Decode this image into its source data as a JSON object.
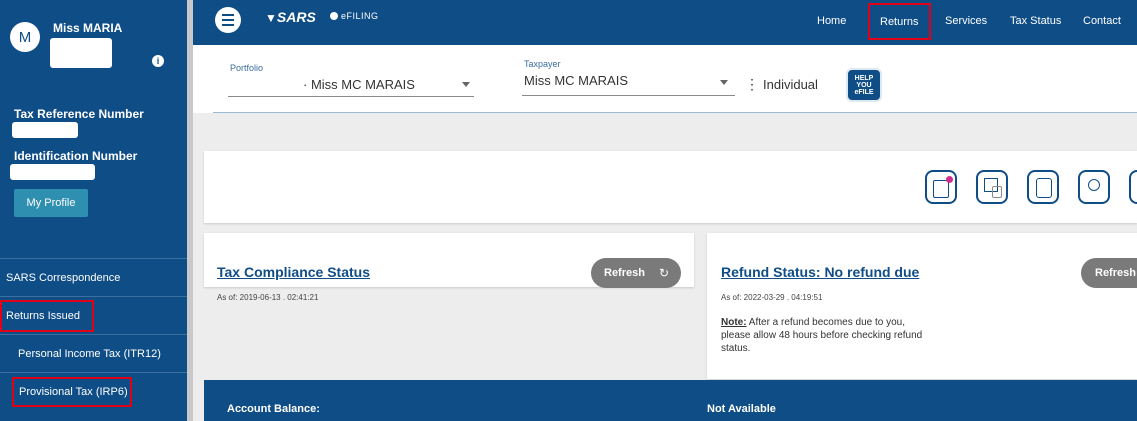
{
  "sidebar": {
    "avatar_initial": "M",
    "user_name": "Miss MARIA",
    "tax_ref_label": "Tax Reference Number",
    "id_number_label": "Identification Number",
    "profile_button": "My Profile",
    "menu": [
      {
        "label": "SARS Correspondence"
      },
      {
        "label": "Returns Issued"
      },
      {
        "label": "Personal Income Tax (ITR12)"
      },
      {
        "label": "Provisional Tax (IRP6)"
      }
    ]
  },
  "topnav": {
    "brand": "SARS",
    "brand_sub": "eFILING",
    "items": [
      "Home",
      "Returns",
      "Services",
      "Tax Status",
      "Contact"
    ]
  },
  "taxpayer_bar": {
    "portfolio_label": "Portfolio",
    "portfolio_value": "· Miss MC MARAIS",
    "taxpayer_label": "Taxpayer",
    "taxpayer_value": "Miss MC MARAIS",
    "entity_type": "Individual",
    "help_badge": "HELP YOU eFILE"
  },
  "compliance": {
    "title": "Tax Compliance Status",
    "as_of": "As of: 2019-06-13 . 02:41:21",
    "refresh_label": "Refresh"
  },
  "refund": {
    "title": "Refund Status: No refund due",
    "as_of": "As of: 2022-03-29 . 04:19:51",
    "note_label": "Note:",
    "note_text": " After a refund becomes due to you, please allow 48 hours before checking refund status.",
    "refresh_label": "Refresh"
  },
  "account": {
    "balance_label": "Account Balance:",
    "status": "Not Available"
  },
  "colors": {
    "primary": "#0f4d87",
    "highlight": "#e0001a",
    "button_grey": "#7a7a7a",
    "profile_button": "#2f8fb0"
  }
}
